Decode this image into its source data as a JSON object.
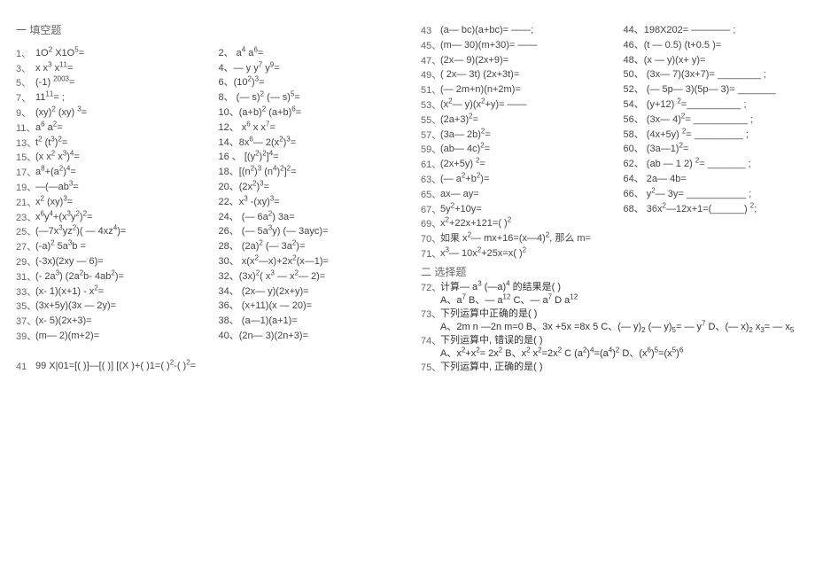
{
  "section1_title": "一 填空题",
  "section2_title": "二 选择题",
  "left": [
    {
      "n": "1、",
      "a": "1O² X1O⁵=",
      "b": "2、 a⁴ a⁶="
    },
    {
      "n": "3、",
      "a": "x x³ x¹¹=",
      "b": "4、— y y⁷ y⁹="
    },
    {
      "n": "5、",
      "a": "(-1) ²⁰⁰³=",
      "b": "6、(10²)³="
    },
    {
      "n": "7、",
      "a": "11¹¹= ;",
      "b": "8、 (— s)² (— s)⁵="
    },
    {
      "n": "9、",
      "a": "(xy)² (xy) ³=",
      "b": "10、(a+b)² (a+b)⁶="
    },
    {
      "n": "11、",
      "a": "a⁶ a²=",
      "b": "12、 x⁶ x x⁷="
    },
    {
      "n": "13、",
      "a": "t² (t³)²=",
      "b": "14、8x⁶— 2(x²)³="
    },
    {
      "n": "15、",
      "a": "(x x² x³)⁴=",
      "b": "16 、 [(y²)²]⁴="
    },
    {
      "n": "17、",
      "a": "a⁸+(a²)⁴=",
      "b": "18、[(n²)³ (n⁴)²]²="
    },
    {
      "n": "19、",
      "a": "—(—ab³=",
      "b": "20、(2x²)³="
    },
    {
      "n": "21、",
      "a": "x² (xy)³=",
      "b": "22、x³ -(xy)³="
    },
    {
      "n": "23、",
      "a": "x⁶y⁴+(x³y²)²=",
      "b": "24、 (— 6a²) 3a="
    },
    {
      "n": "25、",
      "a": "(—7x³yz²)( — 4xz⁴)=",
      "b": "26、 (— 5a³y) (— 3ayc)="
    },
    {
      "n": "27、",
      "a": "(-a)² 5a³b =",
      "b": "28、 (2a)² (— 3a²)="
    },
    {
      "n": "29、",
      "a": "(-3x)(2xy — 6)=",
      "b": "30、 x(x²—x)+2x²(x—1)="
    },
    {
      "n": "31、",
      "a": "(- 2a³) (2a²b- 4ab²)=",
      "b": "32、(3x)²( x³ — x²— 2)="
    },
    {
      "n": "33、",
      "a": "(x- 1)(x+1) - x²=",
      "b": "34、 (2x— y)(2x+y)="
    },
    {
      "n": "35、",
      "a": "(3x+5y)(3x — 2y)=",
      "b": "36、 (x+11)(x — 20)="
    },
    {
      "n": "37、",
      "a": "(x- 5)(2x+3)=",
      "b": "38、 (a—1)(a+1)="
    },
    {
      "n": "39、",
      "a": "(m— 2)(m+2)=",
      "b": "40、(2n— 3)(2n+3)="
    },
    {
      "n": "",
      "a": "",
      "b": ""
    },
    {
      "n": "41",
      "a": "99 X|01=[(       )]—[(          )] [(X      )+( )1=(         )²-(      )²=",
      "b": ""
    }
  ],
  "right_top": [
    {
      "n": "43",
      "a": "(a— bc)(a+bc)=           ——;",
      "b": "44、198X202=  ———— ;"
    },
    {
      "n": "45、",
      "a": "(m— 30)(m+30)=        ——",
      "b": "46、(t — 0.5) (t+0.5 )="
    },
    {
      "n": "47、",
      "a": "(2x— 9)(2x+9)=",
      "b": "48、(x — y)(x+ y)="
    },
    {
      "n": "49、",
      "a": "( 2x— 3t)  (2x+3t)=",
      "b": "50、 (3x— 7)(3x+7)= ________ ;"
    },
    {
      "n": "51、",
      "a": "(— 2m+n)(n+2m)=",
      "b": "52、 (— 5p— 3)(5p— 3)= _______"
    },
    {
      "n": "53、",
      "a": "(x²— y)(x²+y)=           ——",
      "b": "54、 (y+12) ²=__________ ;"
    },
    {
      "n": "55、",
      "a": "(2a+3)²=",
      "b": "56、 (3x— 4)²= __________ ;"
    },
    {
      "n": "57、",
      "a": "(3a— 2b)²=",
      "b": "58、 (4x+5y) ²= _________ ;"
    },
    {
      "n": "59、",
      "a": "(ab— 4c)²=",
      "b": "60、 (3a—1)²="
    },
    {
      "n": "61、",
      "a": "(2x+5y) ²=",
      "b": "62、 (ab — 1 2) ²= _______ ;"
    },
    {
      "n": "63、",
      "a": "(— a²+b²)=",
      "b": "64、 2a— 4b="
    },
    {
      "n": "65、",
      "a": "ax— ay=",
      "b": "66、 y²— 3y= ___________ ;"
    },
    {
      "n": "67、",
      "a": "5y²+10y=",
      "b": "68、 36x²—12x+1=(______) ²;"
    },
    {
      "n": "69、",
      "a": "x²+22x+121=(           )²",
      "b": ""
    },
    {
      "n": "70、",
      "a": "如果 x²— mx+16=(x—4)²,    那么  m=",
      "b": ""
    },
    {
      "n": "71、",
      "a": "x³— 10x²+25x=x(             )²",
      "b": ""
    }
  ],
  "mc": [
    {
      "n": "72、",
      "t": "计算— a³ (—a)⁴ 的结果是(    )"
    },
    {
      "n": "",
      "t": "A、a⁷    B、— a¹²    C、— a⁷     D   a¹²"
    },
    {
      "n": "73、",
      "t": "下列运算中正确的是(    )"
    },
    {
      "n": "",
      "t": "A、2m n —2n m=0  B、3x +5x =8x   5  C、(— y)₂ (— y)₅= — y⁷   D、(— x)₂ x₃= — x₅"
    },
    {
      "n": "74、",
      "t": "下列运算中,  错误的是(    )"
    },
    {
      "n": "",
      "t": "A、x²+x²= 2x²    B、x² x²=2x²     C   (a²)⁴=(a⁴)²    D、(x⁶)⁵=(x⁵)⁶"
    },
    {
      "n": "75、",
      "t": "下列运算中,  正确的是(    )"
    }
  ]
}
